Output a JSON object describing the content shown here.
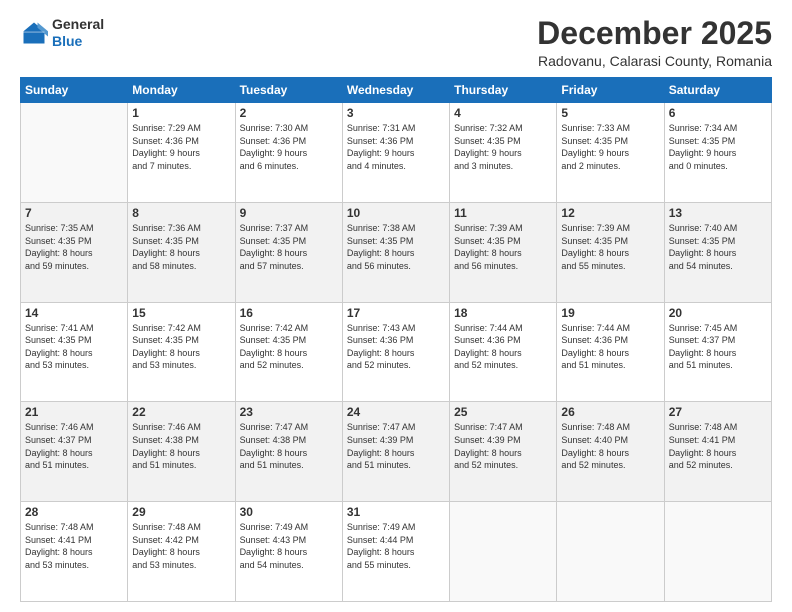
{
  "logo": {
    "general": "General",
    "blue": "Blue"
  },
  "header": {
    "month": "December 2025",
    "location": "Radovanu, Calarasi County, Romania"
  },
  "days_of_week": [
    "Sunday",
    "Monday",
    "Tuesday",
    "Wednesday",
    "Thursday",
    "Friday",
    "Saturday"
  ],
  "weeks": [
    [
      {
        "day": "",
        "info": ""
      },
      {
        "day": "1",
        "info": "Sunrise: 7:29 AM\nSunset: 4:36 PM\nDaylight: 9 hours\nand 7 minutes."
      },
      {
        "day": "2",
        "info": "Sunrise: 7:30 AM\nSunset: 4:36 PM\nDaylight: 9 hours\nand 6 minutes."
      },
      {
        "day": "3",
        "info": "Sunrise: 7:31 AM\nSunset: 4:36 PM\nDaylight: 9 hours\nand 4 minutes."
      },
      {
        "day": "4",
        "info": "Sunrise: 7:32 AM\nSunset: 4:35 PM\nDaylight: 9 hours\nand 3 minutes."
      },
      {
        "day": "5",
        "info": "Sunrise: 7:33 AM\nSunset: 4:35 PM\nDaylight: 9 hours\nand 2 minutes."
      },
      {
        "day": "6",
        "info": "Sunrise: 7:34 AM\nSunset: 4:35 PM\nDaylight: 9 hours\nand 0 minutes."
      }
    ],
    [
      {
        "day": "7",
        "info": "Sunrise: 7:35 AM\nSunset: 4:35 PM\nDaylight: 8 hours\nand 59 minutes."
      },
      {
        "day": "8",
        "info": "Sunrise: 7:36 AM\nSunset: 4:35 PM\nDaylight: 8 hours\nand 58 minutes."
      },
      {
        "day": "9",
        "info": "Sunrise: 7:37 AM\nSunset: 4:35 PM\nDaylight: 8 hours\nand 57 minutes."
      },
      {
        "day": "10",
        "info": "Sunrise: 7:38 AM\nSunset: 4:35 PM\nDaylight: 8 hours\nand 56 minutes."
      },
      {
        "day": "11",
        "info": "Sunrise: 7:39 AM\nSunset: 4:35 PM\nDaylight: 8 hours\nand 56 minutes."
      },
      {
        "day": "12",
        "info": "Sunrise: 7:39 AM\nSunset: 4:35 PM\nDaylight: 8 hours\nand 55 minutes."
      },
      {
        "day": "13",
        "info": "Sunrise: 7:40 AM\nSunset: 4:35 PM\nDaylight: 8 hours\nand 54 minutes."
      }
    ],
    [
      {
        "day": "14",
        "info": "Sunrise: 7:41 AM\nSunset: 4:35 PM\nDaylight: 8 hours\nand 53 minutes."
      },
      {
        "day": "15",
        "info": "Sunrise: 7:42 AM\nSunset: 4:35 PM\nDaylight: 8 hours\nand 53 minutes."
      },
      {
        "day": "16",
        "info": "Sunrise: 7:42 AM\nSunset: 4:35 PM\nDaylight: 8 hours\nand 52 minutes."
      },
      {
        "day": "17",
        "info": "Sunrise: 7:43 AM\nSunset: 4:36 PM\nDaylight: 8 hours\nand 52 minutes."
      },
      {
        "day": "18",
        "info": "Sunrise: 7:44 AM\nSunset: 4:36 PM\nDaylight: 8 hours\nand 52 minutes."
      },
      {
        "day": "19",
        "info": "Sunrise: 7:44 AM\nSunset: 4:36 PM\nDaylight: 8 hours\nand 51 minutes."
      },
      {
        "day": "20",
        "info": "Sunrise: 7:45 AM\nSunset: 4:37 PM\nDaylight: 8 hours\nand 51 minutes."
      }
    ],
    [
      {
        "day": "21",
        "info": "Sunrise: 7:46 AM\nSunset: 4:37 PM\nDaylight: 8 hours\nand 51 minutes."
      },
      {
        "day": "22",
        "info": "Sunrise: 7:46 AM\nSunset: 4:38 PM\nDaylight: 8 hours\nand 51 minutes."
      },
      {
        "day": "23",
        "info": "Sunrise: 7:47 AM\nSunset: 4:38 PM\nDaylight: 8 hours\nand 51 minutes."
      },
      {
        "day": "24",
        "info": "Sunrise: 7:47 AM\nSunset: 4:39 PM\nDaylight: 8 hours\nand 51 minutes."
      },
      {
        "day": "25",
        "info": "Sunrise: 7:47 AM\nSunset: 4:39 PM\nDaylight: 8 hours\nand 52 minutes."
      },
      {
        "day": "26",
        "info": "Sunrise: 7:48 AM\nSunset: 4:40 PM\nDaylight: 8 hours\nand 52 minutes."
      },
      {
        "day": "27",
        "info": "Sunrise: 7:48 AM\nSunset: 4:41 PM\nDaylight: 8 hours\nand 52 minutes."
      }
    ],
    [
      {
        "day": "28",
        "info": "Sunrise: 7:48 AM\nSunset: 4:41 PM\nDaylight: 8 hours\nand 53 minutes."
      },
      {
        "day": "29",
        "info": "Sunrise: 7:48 AM\nSunset: 4:42 PM\nDaylight: 8 hours\nand 53 minutes."
      },
      {
        "day": "30",
        "info": "Sunrise: 7:49 AM\nSunset: 4:43 PM\nDaylight: 8 hours\nand 54 minutes."
      },
      {
        "day": "31",
        "info": "Sunrise: 7:49 AM\nSunset: 4:44 PM\nDaylight: 8 hours\nand 55 minutes."
      },
      {
        "day": "",
        "info": ""
      },
      {
        "day": "",
        "info": ""
      },
      {
        "day": "",
        "info": ""
      }
    ]
  ]
}
